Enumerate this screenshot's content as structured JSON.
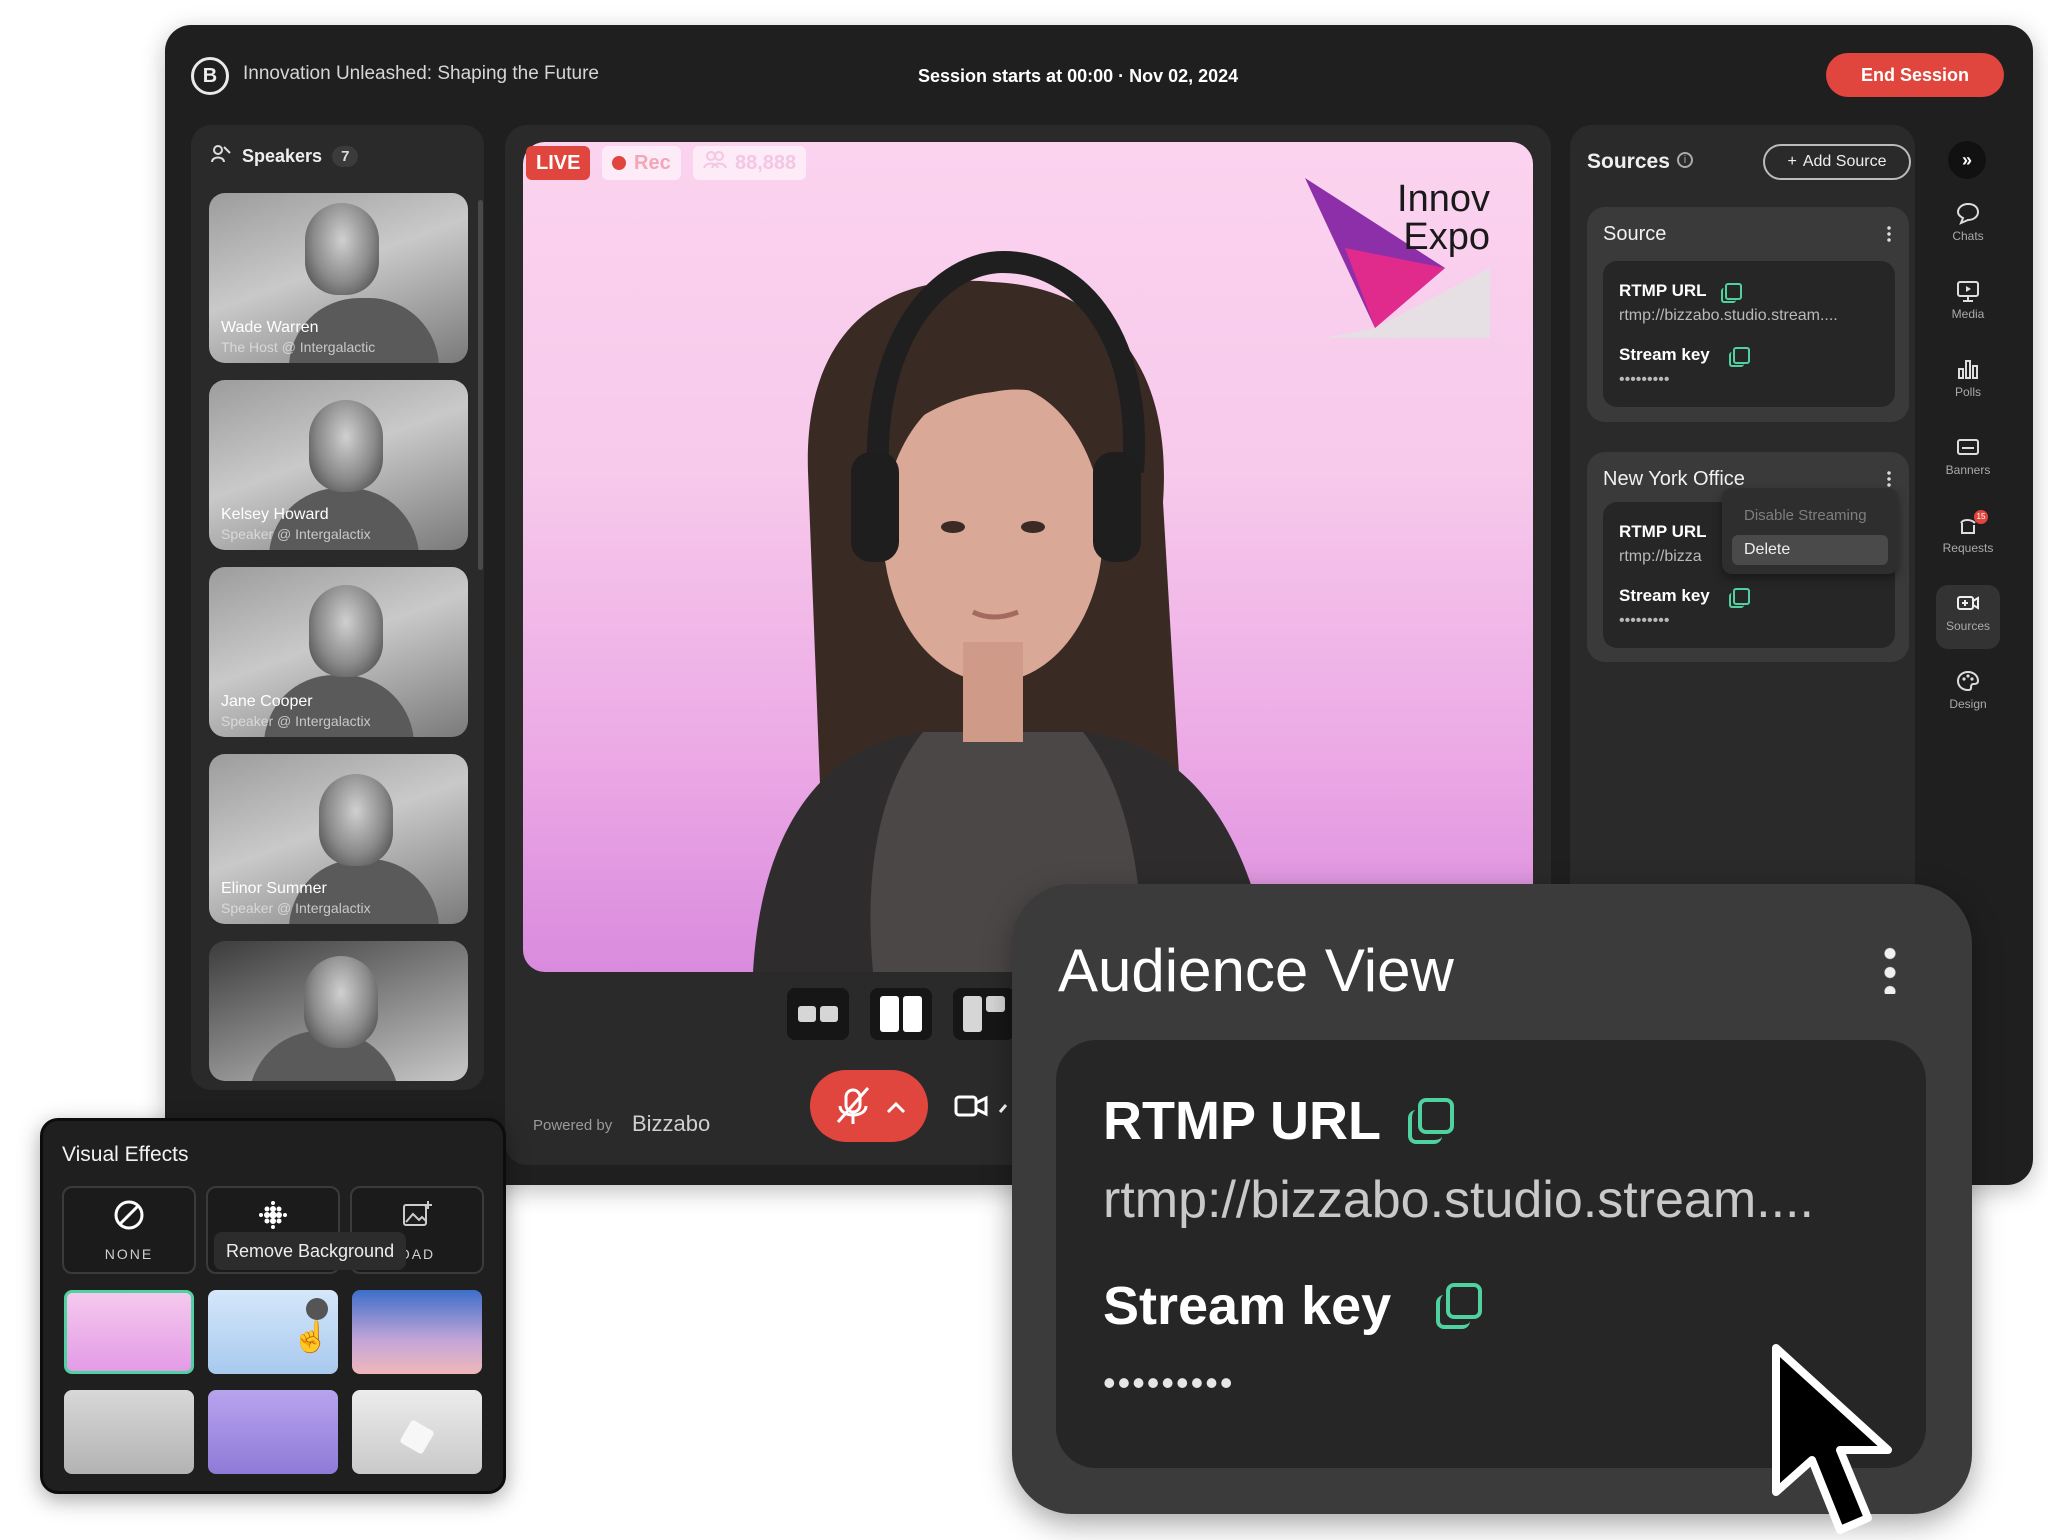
{
  "header": {
    "logo_letter": "B",
    "event_title": "Innovation Unleashed: Shaping the Future",
    "session_info": "Session starts at 00:00 · Nov 02, 2024",
    "end_session_label": "End Session"
  },
  "speakers": {
    "title": "Speakers",
    "count": "7",
    "items": [
      {
        "name": "Wade Warren",
        "role": "The Host @ Intergalactic"
      },
      {
        "name": "Kelsey Howard",
        "role": "Speaker @ Intergalactix"
      },
      {
        "name": "Jane Cooper",
        "role": "Speaker @ Intergalactix"
      },
      {
        "name": "Elinor Summer",
        "role": "Speaker @ Intergalactix"
      },
      {
        "name": "",
        "role": ""
      }
    ]
  },
  "stage": {
    "live_label": "LIVE",
    "rec_label": "Rec",
    "viewers": "88,888",
    "logo_line1": "Innov",
    "logo_line2": "Expo",
    "powered_by": "Powered by",
    "powered_brand": "Bizzabo"
  },
  "sources": {
    "title": "Sources",
    "add_label": "Add Source",
    "cards": [
      {
        "title": "Source",
        "rtmp_label": "RTMP URL",
        "rtmp_value": "rtmp://bizzabo.studio.stream....",
        "key_label": "Stream key",
        "key_value": "•••••••••"
      },
      {
        "title": "New York Office",
        "rtmp_label": "RTMP URL",
        "rtmp_value": "rtmp://bizza",
        "key_label": "Stream key",
        "key_value": "•••••••••"
      }
    ],
    "menu": {
      "disable": "Disable Streaming",
      "delete": "Delete"
    }
  },
  "rail": {
    "items": [
      {
        "label": "Chats",
        "icon": "chat-icon"
      },
      {
        "label": "Media",
        "icon": "media-icon"
      },
      {
        "label": "Polls",
        "icon": "polls-icon"
      },
      {
        "label": "Banners",
        "icon": "banners-icon"
      },
      {
        "label": "Requests",
        "icon": "requests-icon"
      },
      {
        "label": "Sources",
        "icon": "sources-icon"
      },
      {
        "label": "Design",
        "icon": "design-icon"
      }
    ],
    "requests_badge": "15"
  },
  "visual_effects": {
    "title": "Visual Effects",
    "none_label": "NONE",
    "upload_label": "OAD",
    "tooltip": "Remove Background",
    "swatch_colors": [
      "#f0b6ea",
      "#bcd8f3",
      "#8aa0d8",
      "#c8c8c8",
      "#a98fe0",
      "#d9d9d9"
    ]
  },
  "audience_view": {
    "title": "Audience View",
    "rtmp_label": "RTMP URL",
    "rtmp_value": "rtmp://bizzabo.studio.stream....",
    "key_label": "Stream key",
    "key_value": "•••••••••"
  },
  "colors": {
    "accent_red": "#e0463d",
    "copy_green": "#4fd1a0"
  }
}
